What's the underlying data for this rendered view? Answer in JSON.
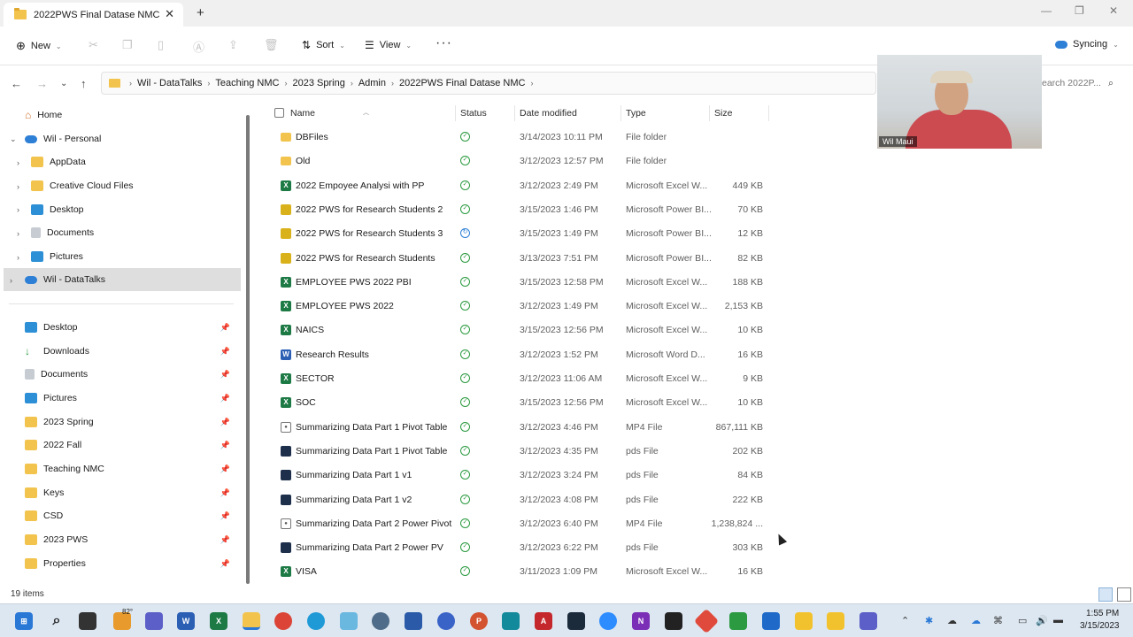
{
  "window": {
    "tab_title": "2022PWS Final Datase NMC",
    "tab_close": "✕",
    "tab_add": "+",
    "minimize": "—",
    "maximize": "❐",
    "close": "✕"
  },
  "toolbar": {
    "new_label": "New",
    "sort_label": "Sort",
    "view_label": "View",
    "more_label": "···",
    "sync_label": "Syncing"
  },
  "address": {
    "crumbs": [
      "Wil - DataTalks",
      "Teaching NMC",
      "2023 Spring",
      "Admin",
      "2022PWS Final Datase NMC"
    ],
    "search_placeholder": "Search 2022P..."
  },
  "sidebar": {
    "top": [
      {
        "label": "Home"
      },
      {
        "label": "Wil - Personal"
      },
      {
        "label": "AppData"
      },
      {
        "label": "Creative Cloud Files"
      },
      {
        "label": "Desktop"
      },
      {
        "label": "Documents"
      },
      {
        "label": "Pictures"
      },
      {
        "label": "Wil - DataTalks"
      }
    ],
    "quick": [
      {
        "label": "Desktop"
      },
      {
        "label": "Downloads"
      },
      {
        "label": "Documents"
      },
      {
        "label": "Pictures"
      },
      {
        "label": "2023 Spring"
      },
      {
        "label": "2022 Fall"
      },
      {
        "label": "Teaching NMC"
      },
      {
        "label": "Keys"
      },
      {
        "label": "CSD"
      },
      {
        "label": "2023 PWS"
      },
      {
        "label": "Properties"
      }
    ]
  },
  "columns": {
    "name": "Name",
    "status": "Status",
    "date": "Date modified",
    "type": "Type",
    "size": "Size"
  },
  "files": [
    {
      "name": "DBFiles",
      "date": "3/14/2023 10:11 PM",
      "type": "File folder",
      "size": "",
      "kind": "folder",
      "status": "ok"
    },
    {
      "name": "Old",
      "date": "3/12/2023 12:57 PM",
      "type": "File folder",
      "size": "",
      "kind": "folder",
      "status": "ok"
    },
    {
      "name": "2022 Empoyee Analysi with PP",
      "date": "3/12/2023 2:49 PM",
      "type": "Microsoft Excel W...",
      "size": "449 KB",
      "kind": "excel",
      "status": "ok"
    },
    {
      "name": "2022 PWS for Research Students 2",
      "date": "3/15/2023 1:46 PM",
      "type": "Microsoft Power BI...",
      "size": "70 KB",
      "kind": "pbi",
      "status": "ok"
    },
    {
      "name": "2022 PWS for Research Students 3",
      "date": "3/15/2023 1:49 PM",
      "type": "Microsoft Power BI...",
      "size": "12 KB",
      "kind": "pbi",
      "status": "sync"
    },
    {
      "name": "2022 PWS for Research Students",
      "date": "3/13/2023 7:51 PM",
      "type": "Microsoft Power BI...",
      "size": "82 KB",
      "kind": "pbi",
      "status": "ok"
    },
    {
      "name": "EMPLOYEE PWS 2022 PBI",
      "date": "3/15/2023 12:58 PM",
      "type": "Microsoft Excel W...",
      "size": "188 KB",
      "kind": "excel",
      "status": "ok"
    },
    {
      "name": "EMPLOYEE PWS 2022",
      "date": "3/12/2023 1:49 PM",
      "type": "Microsoft Excel W...",
      "size": "2,153 KB",
      "kind": "excel",
      "status": "ok"
    },
    {
      "name": "NAICS",
      "date": "3/15/2023 12:56 PM",
      "type": "Microsoft Excel W...",
      "size": "10 KB",
      "kind": "excel",
      "status": "ok"
    },
    {
      "name": "Research Results",
      "date": "3/12/2023 1:52 PM",
      "type": "Microsoft Word D...",
      "size": "16 KB",
      "kind": "word",
      "status": "ok"
    },
    {
      "name": "SECTOR",
      "date": "3/12/2023 11:06 AM",
      "type": "Microsoft Excel W...",
      "size": "9 KB",
      "kind": "excel",
      "status": "ok"
    },
    {
      "name": "SOC",
      "date": "3/15/2023 12:56 PM",
      "type": "Microsoft Excel W...",
      "size": "10 KB",
      "kind": "excel",
      "status": "ok"
    },
    {
      "name": "Summarizing Data Part 1 Pivot Table",
      "date": "3/12/2023 4:46 PM",
      "type": "MP4 File",
      "size": "867,111 KB",
      "kind": "mp4",
      "status": "ok"
    },
    {
      "name": "Summarizing Data Part 1 Pivot Table",
      "date": "3/12/2023 4:35 PM",
      "type": "pds File",
      "size": "202 KB",
      "kind": "pds",
      "status": "ok"
    },
    {
      "name": "Summarizing Data Part 1 v1",
      "date": "3/12/2023 3:24 PM",
      "type": "pds File",
      "size": "84 KB",
      "kind": "pds",
      "status": "ok"
    },
    {
      "name": "Summarizing Data Part 1 v2",
      "date": "3/12/2023 4:08 PM",
      "type": "pds File",
      "size": "222 KB",
      "kind": "pds",
      "status": "ok"
    },
    {
      "name": "Summarizing Data Part 2 Power Pivot",
      "date": "3/12/2023 6:40 PM",
      "type": "MP4 File",
      "size": "1,238,824 ...",
      "kind": "mp4",
      "status": "ok"
    },
    {
      "name": "Summarizing Data Part 2 Power PV",
      "date": "3/12/2023 6:22 PM",
      "type": "pds File",
      "size": "303 KB",
      "kind": "pds",
      "status": "ok"
    },
    {
      "name": "VISA",
      "date": "3/11/2023 1:09 PM",
      "type": "Microsoft Excel W...",
      "size": "16 KB",
      "kind": "excel",
      "status": "ok"
    }
  ],
  "statusbar": {
    "item_count": "19 items"
  },
  "webcam": {
    "name": "Wil Maui"
  },
  "taskbar": {
    "weather_temp": "82°",
    "time": "1:55 PM",
    "date": "3/15/2023"
  },
  "colors": {
    "folder": "#f2c44e",
    "excel": "#1d7a45",
    "pbi": "#d9b21b",
    "word": "#2b5fb4",
    "pds": "#1d2f4a",
    "mp4": "#555555"
  }
}
